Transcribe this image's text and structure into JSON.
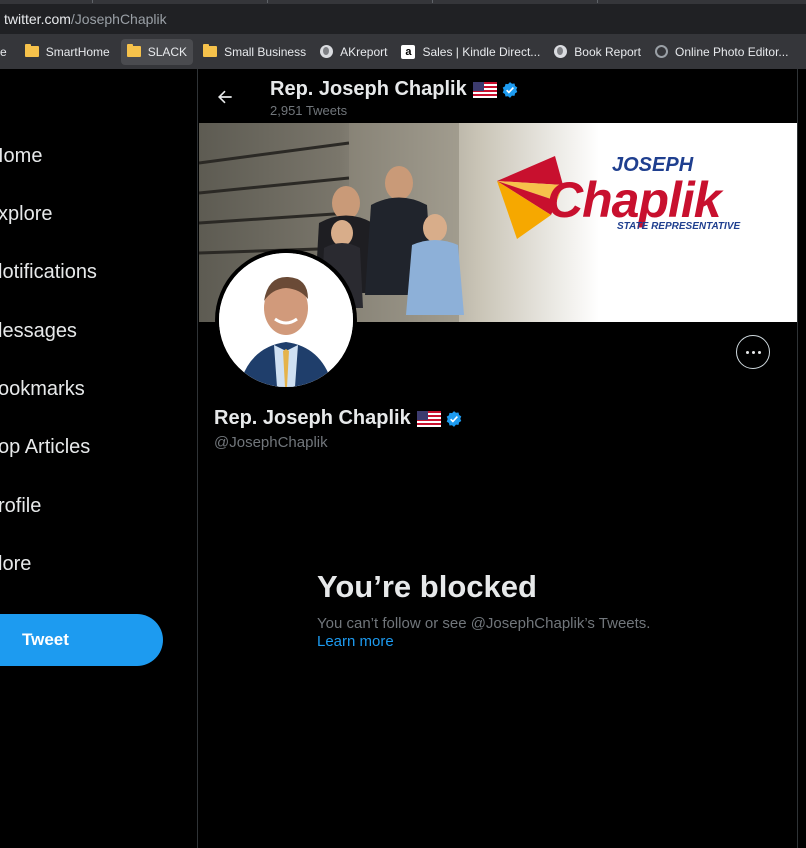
{
  "browser": {
    "url_host": "twitter.com",
    "url_path": "/JosephChaplik",
    "bookmarks": [
      {
        "label": "e",
        "icon": "folder-icon"
      },
      {
        "label": "SmartHome",
        "icon": "folder-icon"
      },
      {
        "label": "SLACK",
        "icon": "folder-icon",
        "active": true
      },
      {
        "label": "Small Business",
        "icon": "folder-icon"
      },
      {
        "label": "AKreport",
        "icon": "globe-icon"
      },
      {
        "label": "Sales | Kindle Direct...",
        "icon": "amazon-icon"
      },
      {
        "label": "Book Report",
        "icon": "globe-icon"
      },
      {
        "label": "Online Photo Editor...",
        "icon": "aperture-icon"
      }
    ]
  },
  "nav": {
    "items": [
      "Home",
      "Explore",
      "Notifications",
      "Messages",
      "Bookmarks",
      "Top Articles",
      "Profile",
      "More"
    ],
    "items_visible": [
      "Iome",
      "xplore",
      "lotifications",
      "lessages",
      "ookmarks",
      "op Articles",
      "rofile",
      "lore"
    ],
    "tweet_label": "Tweet"
  },
  "header": {
    "name": "Rep. Joseph Chaplik",
    "tweet_count": "2,951 Tweets"
  },
  "banner": {
    "logo_top": "JOSEPH",
    "logo_main": "Chaplik",
    "logo_sub": "STATE REPRESENTATIVE"
  },
  "profile": {
    "name": "Rep. Joseph Chaplik",
    "handle": "@JosephChaplik"
  },
  "blocked": {
    "title": "You’re blocked",
    "message": "You can’t follow or see @JosephChaplik’s Tweets.",
    "learn_more": "Learn more"
  },
  "colors": {
    "accent": "#1d9bf0",
    "background": "#000000",
    "muted_text": "#71767b"
  }
}
